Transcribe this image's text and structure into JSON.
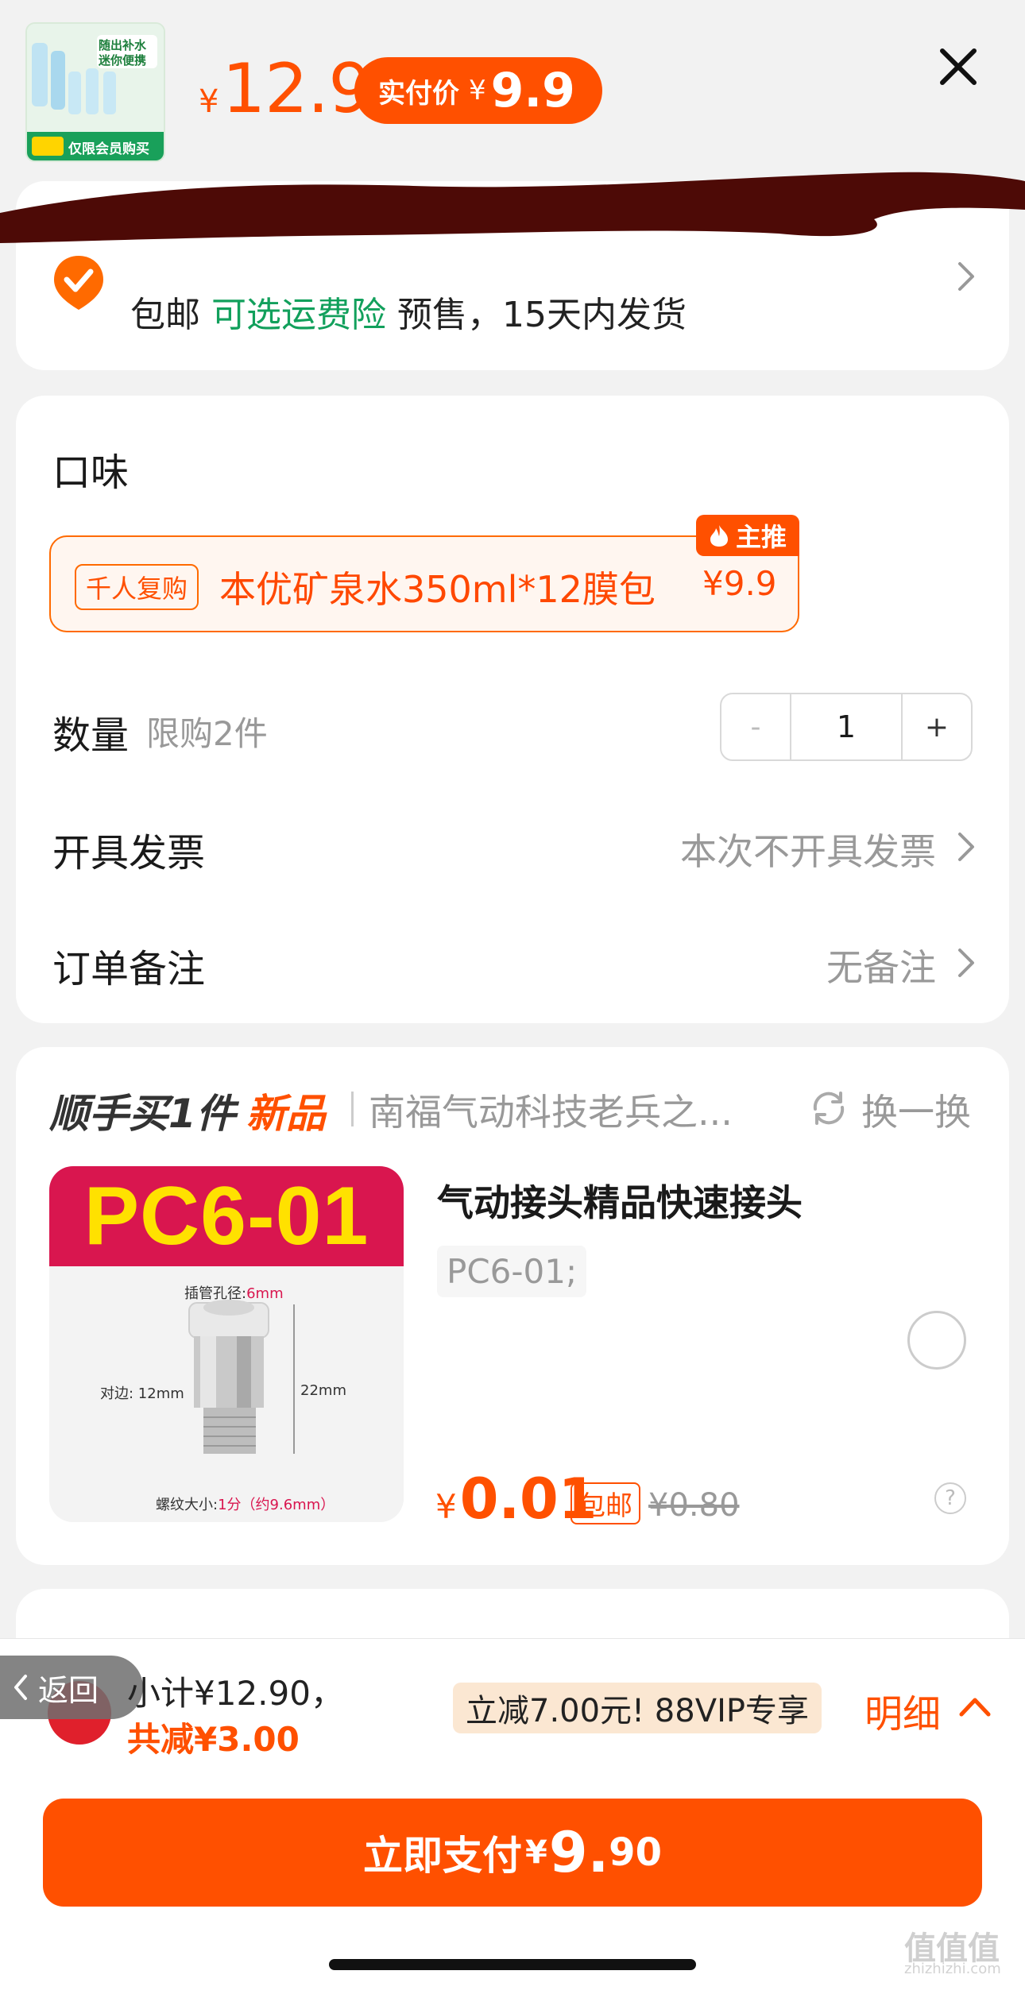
{
  "header": {
    "orig_currency": "¥",
    "orig_price": "12.9",
    "pay_label": "实付价",
    "pay_currency": "¥",
    "pay_price": "9.9",
    "thumb_line1": "随出补水",
    "thumb_line2": "迷你便携",
    "thumb_bottom": "仅限会员购买"
  },
  "shipping": {
    "free": "包邮",
    "insurance": "可选运费险",
    "presale": "预售，15天内发货"
  },
  "options": {
    "flavor_title": "口味",
    "flavor_tag": "千人复购",
    "flavor_name": "本优矿泉水350ml*12膜包",
    "flavor_price": "¥9.9",
    "badge": "主推",
    "qty_label": "数量",
    "qty_limit": "限购2件",
    "qty_minus": "-",
    "qty_value": "1",
    "qty_plus": "+",
    "invoice_label": "开具发票",
    "invoice_value": "本次不开具发票",
    "note_label": "订单备注",
    "note_value": "无备注"
  },
  "recommend": {
    "title": "顺手买1件",
    "new_tag": "新品",
    "shop": "南福气动科技老兵之...",
    "swap": "换一换",
    "banner": "PC6-01",
    "img_label_top": "插管孔径:",
    "img_label_top_val": "6mm",
    "img_label_left": "对边: 12mm",
    "img_label_right": "22mm",
    "img_label_bottom": "螺纹大小:",
    "img_label_bottom_val": "1分（约9.6mm）",
    "name": "气动接头精品快速接头",
    "spec": "PC6-01;",
    "currency": "¥",
    "price": "0.01",
    "free_tag": "包邮",
    "old_price": "¥0.80",
    "help": "?"
  },
  "bottom": {
    "back": "返回",
    "subtotal": "小计¥12.90，",
    "saved": "共减¥3.00",
    "vip": "立减7.00元! 88VIP专享",
    "detail": "明细",
    "pay_label": "立即支付",
    "pay_currency": "¥",
    "pay_int": "9.",
    "pay_dec": "90"
  },
  "watermark": {
    "logo": "值值值",
    "url": "zhizhizhi.com"
  },
  "colors": {
    "accent": "#ff5000",
    "green": "#12a05c"
  }
}
